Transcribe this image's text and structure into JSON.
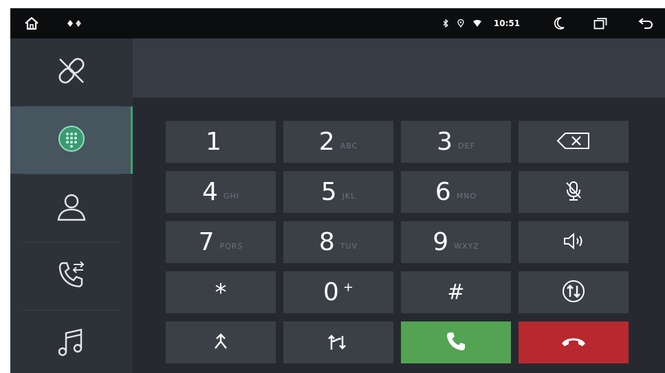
{
  "status_bar": {
    "time": "10:51",
    "icons": [
      "home-icon",
      "usb-icon",
      "bluetooth-icon",
      "location-icon",
      "wifi-icon",
      "moon-icon",
      "recent-apps-icon",
      "back-icon"
    ]
  },
  "sidebar": {
    "items": [
      {
        "name": "link",
        "icon": "link-icon",
        "active": false
      },
      {
        "name": "dialpad",
        "icon": "dialpad-icon",
        "active": true
      },
      {
        "name": "contacts",
        "icon": "contact-icon",
        "active": false
      },
      {
        "name": "call-log",
        "icon": "call-log-icon",
        "active": false
      },
      {
        "name": "music",
        "icon": "music-note-icon",
        "active": false
      }
    ]
  },
  "display": {
    "number": ""
  },
  "keypad": {
    "keys": [
      {
        "digit": "1",
        "letters": ""
      },
      {
        "digit": "2",
        "letters": "ABC"
      },
      {
        "digit": "3",
        "letters": "DEF"
      },
      {
        "digit": "4",
        "letters": "GHI"
      },
      {
        "digit": "5",
        "letters": "JKL"
      },
      {
        "digit": "6",
        "letters": "MNO"
      },
      {
        "digit": "7",
        "letters": "PQRS"
      },
      {
        "digit": "8",
        "letters": "TUV"
      },
      {
        "digit": "9",
        "letters": "WXYZ"
      },
      {
        "digit": "*",
        "letters": ""
      },
      {
        "digit": "0",
        "letters": "",
        "extra": "+"
      },
      {
        "digit": "#",
        "letters": ""
      }
    ],
    "side_actions": [
      "backspace-icon",
      "mute-mic-icon",
      "speaker-icon",
      "transfer-icon"
    ],
    "bottom_actions": [
      "merge-call-icon",
      "swap-call-icon",
      "call-icon",
      "hang-up-icon"
    ]
  },
  "colors": {
    "active_accent": "#3aa86b",
    "call_green": "#54a353",
    "end_red": "#b7282f",
    "key_bg": "#3b4047"
  }
}
